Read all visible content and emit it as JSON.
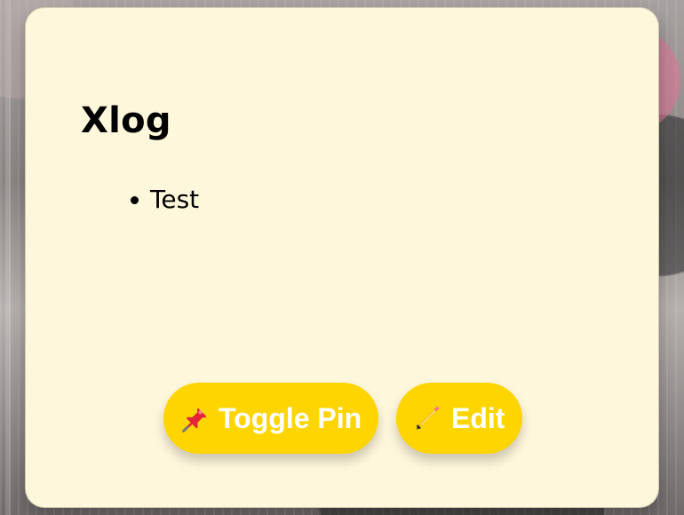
{
  "note": {
    "title": "Xlog",
    "items": [
      "Test"
    ]
  },
  "actions": {
    "toggle_pin": {
      "label": "Toggle Pin",
      "icon": "pushpin-icon"
    },
    "edit": {
      "label": "Edit",
      "icon": "pencil-icon"
    }
  },
  "colors": {
    "card_background": "#fff7dc",
    "button_background": "#ffd500",
    "button_text": "#ffffff",
    "text": "#000000"
  }
}
